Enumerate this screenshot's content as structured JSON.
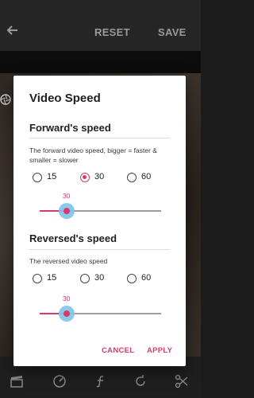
{
  "toolbar": {
    "back_icon": "arrow-left-icon",
    "reset_label": "RESET",
    "save_label": "SAVE"
  },
  "dialog": {
    "title": "Video Speed",
    "forward": {
      "title": "Forward's speed",
      "description": "The forward video speed, bigger = faster & smaller = slower",
      "options": [
        "15",
        "30",
        "60"
      ],
      "selected": "30",
      "slider_value": "30",
      "slider_fraction": 0.22
    },
    "reversed": {
      "title": "Reversed's speed",
      "description": "The reversed video speed",
      "options": [
        "15",
        "30",
        "60"
      ],
      "selected": null,
      "slider_value": "30",
      "slider_fraction": 0.22
    },
    "cancel_label": "CANCEL",
    "apply_label": "APPLY"
  },
  "bottom_bar": {
    "icons": [
      "clapperboard-icon",
      "speedometer-icon",
      "function-icon",
      "rotate-icon",
      "scissors-icon"
    ]
  },
  "colors": {
    "accent": "#d63c6a",
    "thumb_halo": "#7ec4e8",
    "topbar": "#262626"
  }
}
